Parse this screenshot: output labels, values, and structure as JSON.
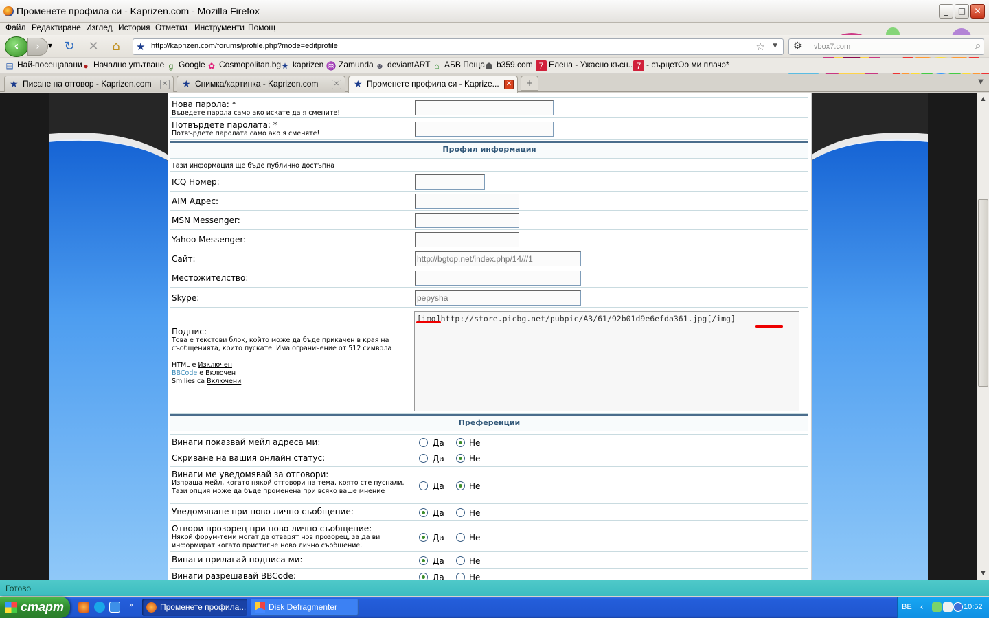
{
  "window": {
    "title": "Променете профила си - Kaprizen.com - Mozilla Firefox"
  },
  "menu": [
    "Файл",
    "Редактиране",
    "Изглед",
    "История",
    "Отметки",
    "Инструменти",
    "Помощ"
  ],
  "nav": {
    "url": "http://kaprizen.com/forums/profile.php?mode=editprofile",
    "search_placeholder": "vbox7.com"
  },
  "bookmarks": [
    "Най-посещавани",
    "Начално упътване",
    "Google",
    "Cosmopolitan.bg",
    "kaprizen",
    "Zamunda",
    "deviantART",
    "АБВ Поща",
    "b359.com",
    "Елена - Ужасно късн...",
    "- сърцетОо ми плачэ*"
  ],
  "tabs": [
    "Писане на отговор - Kaprizen.com",
    "Снимка/картинка - Kaprizen.com",
    "Променете профила си - Kaprize..."
  ],
  "form": {
    "new_password": {
      "label": "Нова парола: *",
      "hint": "Въведете парола само ако искате да я смените!"
    },
    "confirm_password": {
      "label": "Потвърдете паролата: *",
      "hint": "Потвърдете паролата само ако я сменяте!"
    },
    "profile_section": "Профил информация",
    "profile_note": "Тази информация ще бъде публично достъпна",
    "icq": {
      "label": "ICQ Номер:",
      "value": ""
    },
    "aim": {
      "label": "AIM Адрес:",
      "value": ""
    },
    "msn": {
      "label": "MSN Messenger:",
      "value": ""
    },
    "yahoo": {
      "label": "Yahoo Messenger:",
      "value": ""
    },
    "website": {
      "label": "Сайт:",
      "value": "http://bgtop.net/index.php/14///1"
    },
    "location": {
      "label": "Местожителство:",
      "value": ""
    },
    "skype": {
      "label": "Skype:",
      "value": "pepysha"
    },
    "signature": {
      "label": "Подпис:",
      "hint": "Това е текстови блок, който може да бъде прикачен в края на съобщенията, които пускате. Има ограничение от 512 символа",
      "value": "[img]http://store.picbg.net/pubpic/A3/61/92b01d9e6efda361.jpg[/img]",
      "html_prefix": "HTML е",
      "html_state": "Изключен",
      "bbcode_prefix": "BBCode",
      "bbcode_mid": "е",
      "bbcode_state": "Включен",
      "smilies_prefix": "Smilies са",
      "smilies_state": "Включени"
    },
    "prefs_section": "Преференции",
    "yes": "Да",
    "no": "Не",
    "prefs": [
      {
        "label": "Винаги показвай мейл адреса ми:",
        "hint": "",
        "value": "Не"
      },
      {
        "label": "Скриване на вашия онлайн статус:",
        "hint": "",
        "value": "Не"
      },
      {
        "label": "Винаги ме уведомявай за отговори:",
        "hint": "Изпраща мейл, когато някой отговори на тема, която сте пуснали. Тази опция може да бъде променена при всяко ваше мнение",
        "value": "Не"
      },
      {
        "label": "Уведомяване при ново лично съобщение:",
        "hint": "",
        "value": "Да"
      },
      {
        "label": "Отвори прозорец при ново лично съобщение:",
        "hint": "Някой форум-теми могат да отварят нов прозорец, за да ви информират когато пристигне ново лично съобщение.",
        "value": "Да"
      },
      {
        "label": "Винаги прилагай подписа ми:",
        "hint": "",
        "value": "Да"
      },
      {
        "label": "Винаги разрешавай BBCode:",
        "hint": "",
        "value": "Да"
      }
    ]
  },
  "status": "Готово",
  "taskbar": {
    "start": "старт",
    "tasks": [
      "Променете профила...",
      "Disk Defragmenter"
    ],
    "lang": "BE",
    "time": "10:52"
  },
  "colors": {
    "accent": "#315778",
    "underline": "#e00000",
    "status_bar": "#45c4c6",
    "taskbar": "#245edb"
  }
}
